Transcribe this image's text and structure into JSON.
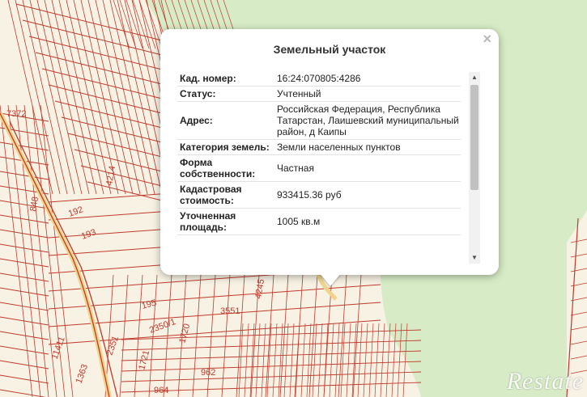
{
  "colors": {
    "water": "#d7ecc6",
    "land": "#f7f2e4",
    "parcel_line": "#c0392b",
    "road": "#f1d48c"
  },
  "map": {
    "parcel_labels": [
      {
        "text": "7372"
      },
      {
        "text": "4214"
      },
      {
        "text": "848"
      },
      {
        "text": "192"
      },
      {
        "text": "193"
      },
      {
        "text": "4245"
      },
      {
        "text": "195"
      },
      {
        "text": "3551"
      },
      {
        "text": "2350/1"
      },
      {
        "text": "1720"
      },
      {
        "text": "2351"
      },
      {
        "text": "11411"
      },
      {
        "text": "1721"
      },
      {
        "text": "1363"
      },
      {
        "text": "962"
      },
      {
        "text": "964"
      }
    ]
  },
  "popup": {
    "title": "Земельный участок",
    "close_symbol": "×",
    "rows": [
      {
        "key": "Кад. номер:",
        "value": "16:24:070805:4286"
      },
      {
        "key": "Статус:",
        "value": "Учтенный"
      },
      {
        "key": "Адрес:",
        "value": "Российская Федерация, Республика Татарстан, Лаишевский муниципальный район, д Каипы"
      },
      {
        "key": "Категория земель:",
        "value": "Земли населенных пунктов"
      },
      {
        "key": "Форма собственности:",
        "value": "Частная"
      },
      {
        "key": "Кадастровая стоимость:",
        "value": "933415.36 руб"
      },
      {
        "key": "Уточненная площадь:",
        "value": "1005 кв.м"
      }
    ]
  },
  "watermark": "Restate"
}
